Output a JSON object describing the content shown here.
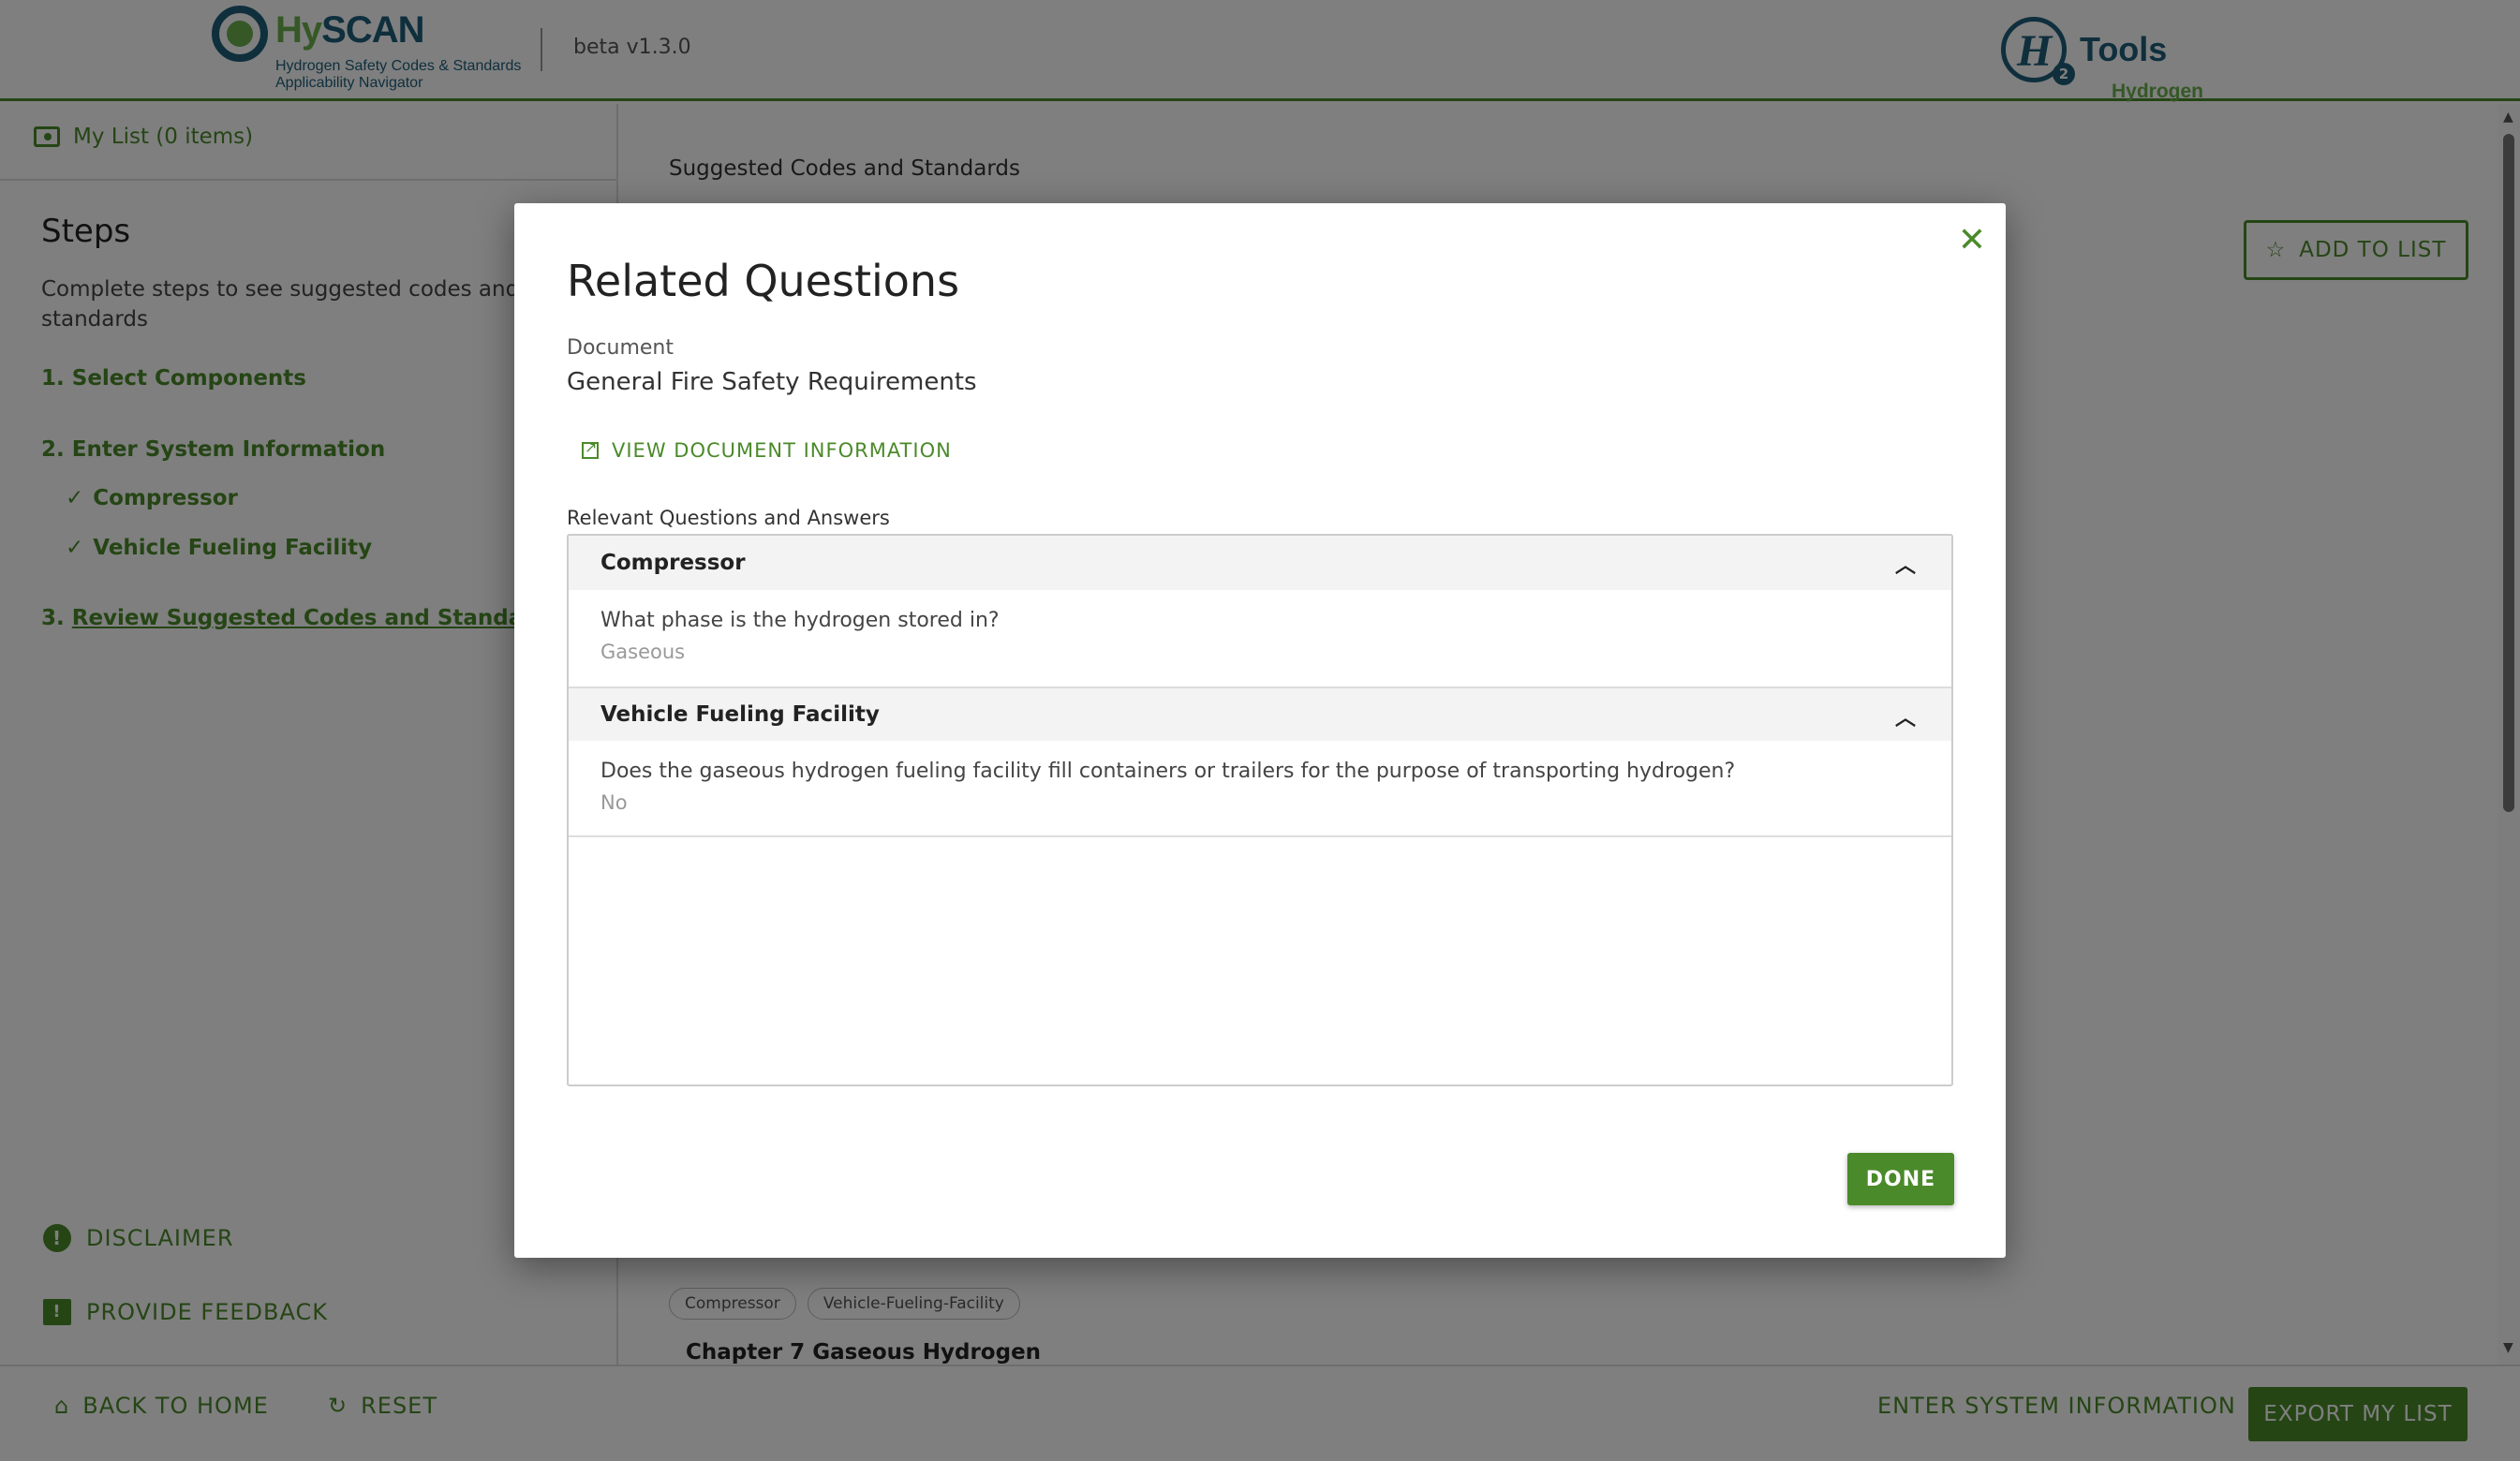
{
  "header": {
    "logo_prefix": "Hy",
    "logo_main": "SCAN",
    "logo_subtitle": "Hydrogen Safety Codes & Standards Applicability Navigator",
    "version": "beta v1.3.0",
    "partner_logo_a": "Hydrogen",
    "partner_logo_b": "Tools",
    "partner_logo_h": "H",
    "partner_logo_2": "2"
  },
  "sidebar": {
    "my_list": "My List (0 items)",
    "steps_title": "Steps",
    "steps_desc": "Complete steps to see suggested codes and standards",
    "step1": "1. Select Components",
    "step2": "2. Enter System Information",
    "sub1": "Compressor",
    "sub2": "Vehicle Fueling Facility",
    "step3_num": "3. ",
    "step3_text": "Review Suggested Codes and Standards",
    "disclaimer": "DISCLAIMER",
    "feedback": "PROVIDE FEEDBACK"
  },
  "main": {
    "suggested_title": "Suggested Codes and Standards",
    "add_to_list": "ADD TO LIST",
    "tags": [
      "Compressor",
      "Vehicle-Fueling-Facility"
    ],
    "chapter": "Chapter 7 Gaseous Hydrogen"
  },
  "footer": {
    "back_home": "BACK TO HOME",
    "reset": "RESET",
    "enter_system": "ENTER SYSTEM INFORMATION",
    "export": "EXPORT MY LIST"
  },
  "modal": {
    "title": "Related Questions",
    "document_label": "Document",
    "document_name": "General Fire Safety Requirements",
    "view_doc": "VIEW DOCUMENT INFORMATION",
    "relevant_label": "Relevant Questions and Answers",
    "sections": [
      {
        "heading": "Compressor",
        "question": "What phase is the hydrogen stored in?",
        "answer": "Gaseous"
      },
      {
        "heading": "Vehicle Fueling Facility",
        "question": "Does the gaseous hydrogen fueling facility fill containers or trailers for the purpose of transporting hydrogen?",
        "answer": "No"
      }
    ],
    "done": "DONE"
  },
  "icons": {
    "close": "close-icon",
    "chevron": "chevron-up-icon",
    "star": "star-icon",
    "home": "home-icon",
    "reset": "reset-icon"
  },
  "colors": {
    "accent": "#4b8a2a",
    "brand_blue": "#1f5f7a",
    "brand_green": "#6ab04c"
  }
}
